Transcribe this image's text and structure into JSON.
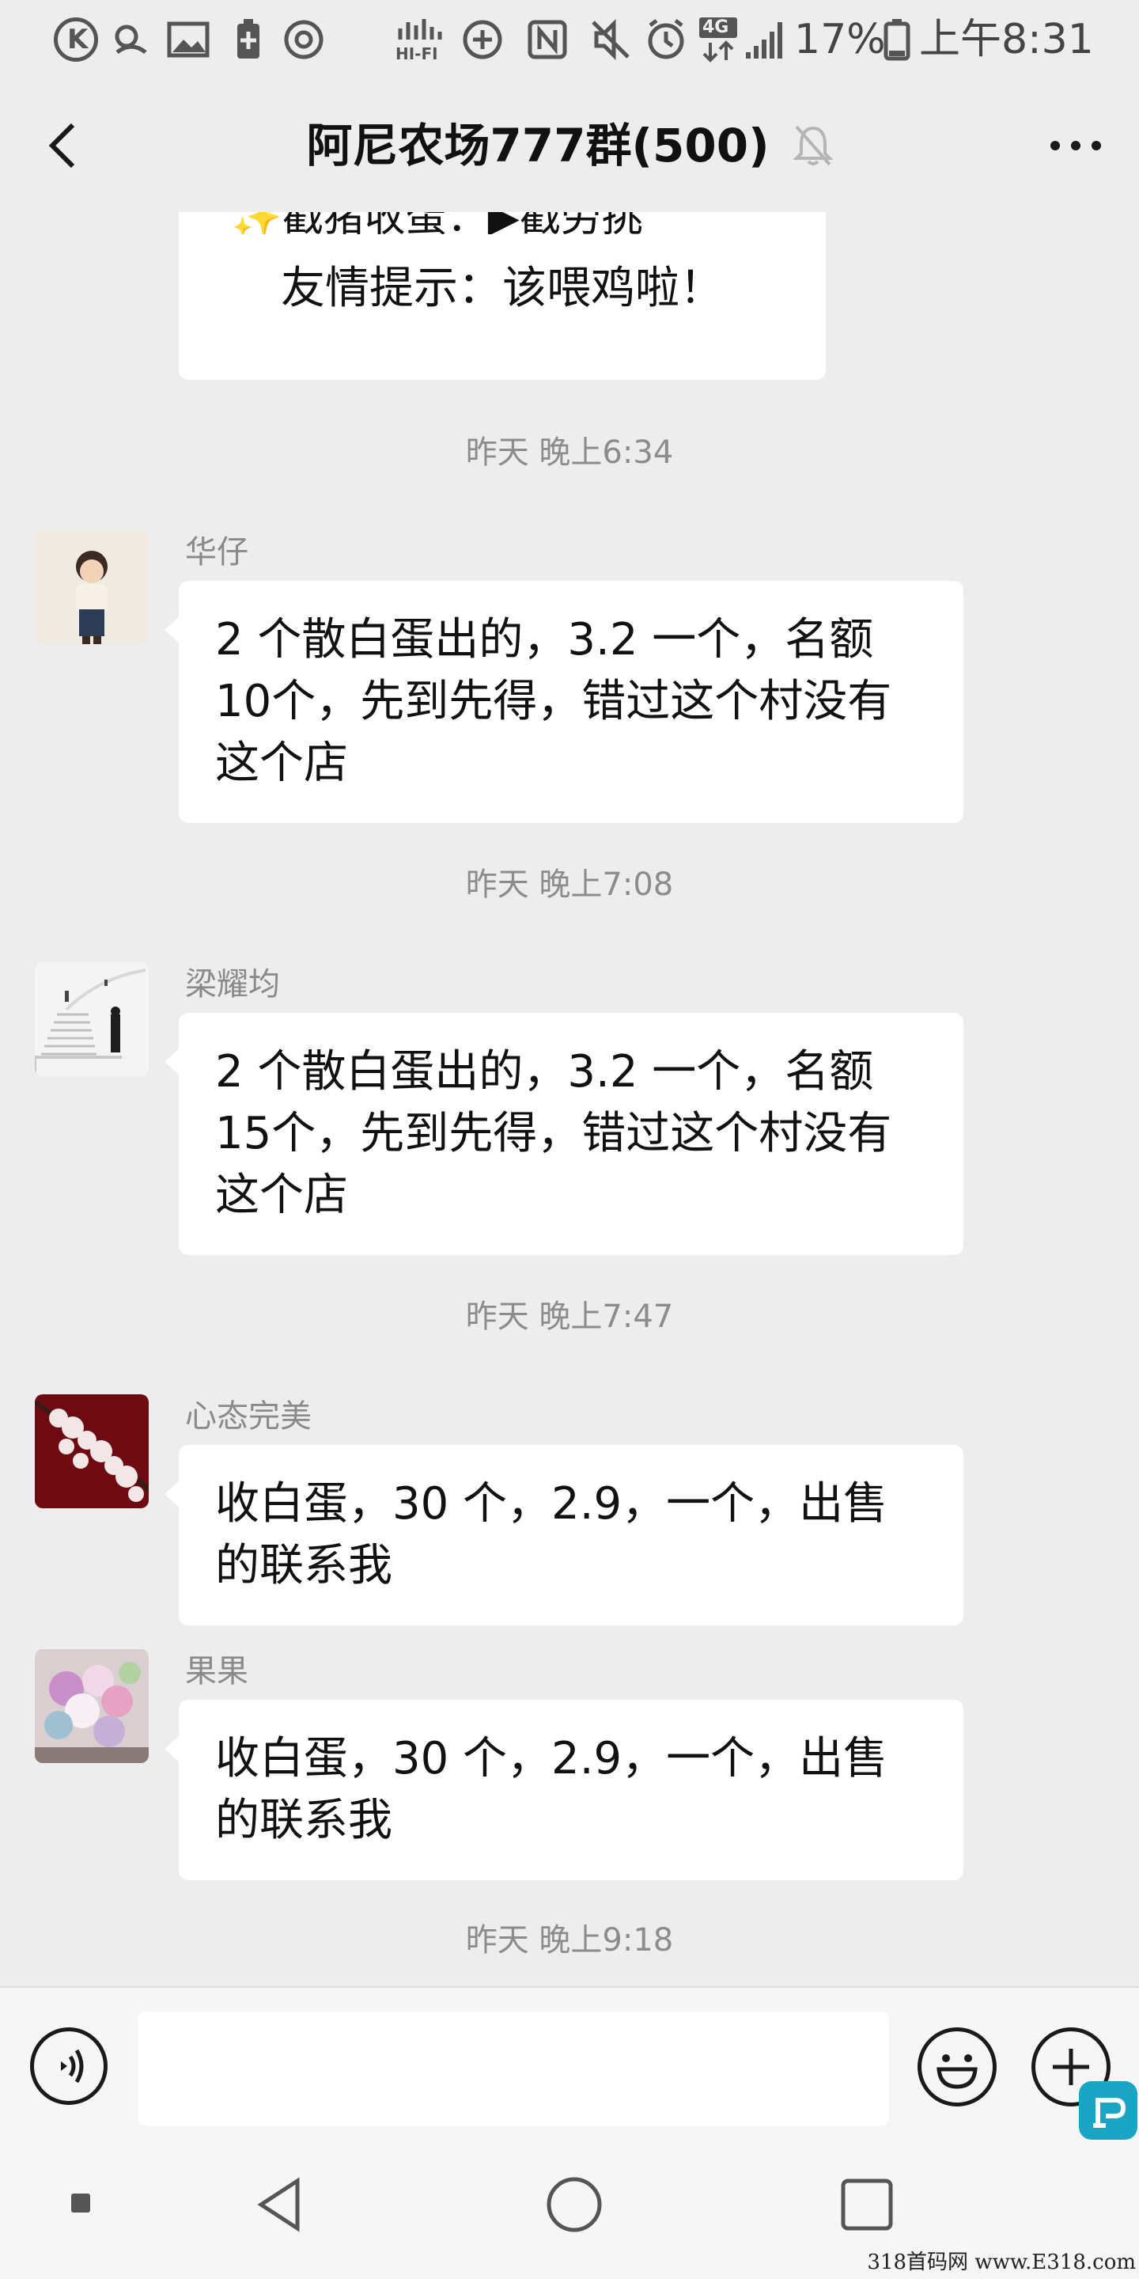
{
  "status_bar": {
    "battery": "17%",
    "time": "上午8:31",
    "icons": [
      "kkbox-icon",
      "weather-icon",
      "image-icon",
      "battery-saver-icon",
      "chrome-icon",
      "hifi-icon",
      "data-saver-icon",
      "nfc-icon",
      "mute-icon",
      "alarm-icon",
      "4g-icon",
      "signal-icon",
      "battery-icon"
    ],
    "hifi_label": "HI-FI",
    "lte_label": "4G"
  },
  "header": {
    "title": "阿尼农场777群(500)",
    "back_icon": "chevron-left-icon",
    "mute_icon": "bell-muted-icon",
    "more_icon": "more-dots-icon"
  },
  "chat": {
    "partial_message": {
      "cut_line": "✨戳猪收蛋：▶戳劳挑",
      "text": "友情提示：该喂鸡啦！"
    },
    "items": [
      {
        "timestamp": "昨天 晚上6:34"
      },
      {
        "sender": "华仔",
        "text": "2 个散白蛋出的，3.2 一个，名额\n10个，先到先得，错过这个村没有\n这个店"
      },
      {
        "timestamp": "昨天 晚上7:08"
      },
      {
        "sender": "梁耀均",
        "text": "2 个散白蛋出的，3.2 一个，名额\n15个，先到先得，错过这个村没有\n这个店"
      },
      {
        "timestamp": "昨天 晚上7:47"
      },
      {
        "sender": "心态完美",
        "text": "收白蛋，30 个，2.9，一个，出售\n的联系我"
      },
      {
        "sender": "果果",
        "text": "收白蛋，30 个，2.9，一个，出售\n的联系我"
      },
      {
        "timestamp": "昨天 晚上9:18"
      }
    ]
  },
  "input_bar": {
    "voice_icon": "voice-icon",
    "emoji_icon": "emoji-icon",
    "plus_icon": "plus-icon"
  },
  "nav_bar": {
    "icons": [
      "recent-dot-icon",
      "back-triangle-icon",
      "home-circle-icon",
      "overview-square-icon"
    ]
  },
  "watermark": "318首码网 www.E318.com",
  "colors": {
    "background": "#ededed",
    "bubble": "#ffffff",
    "timestamp": "#8c8c8c",
    "sender": "#8a8a8a"
  }
}
